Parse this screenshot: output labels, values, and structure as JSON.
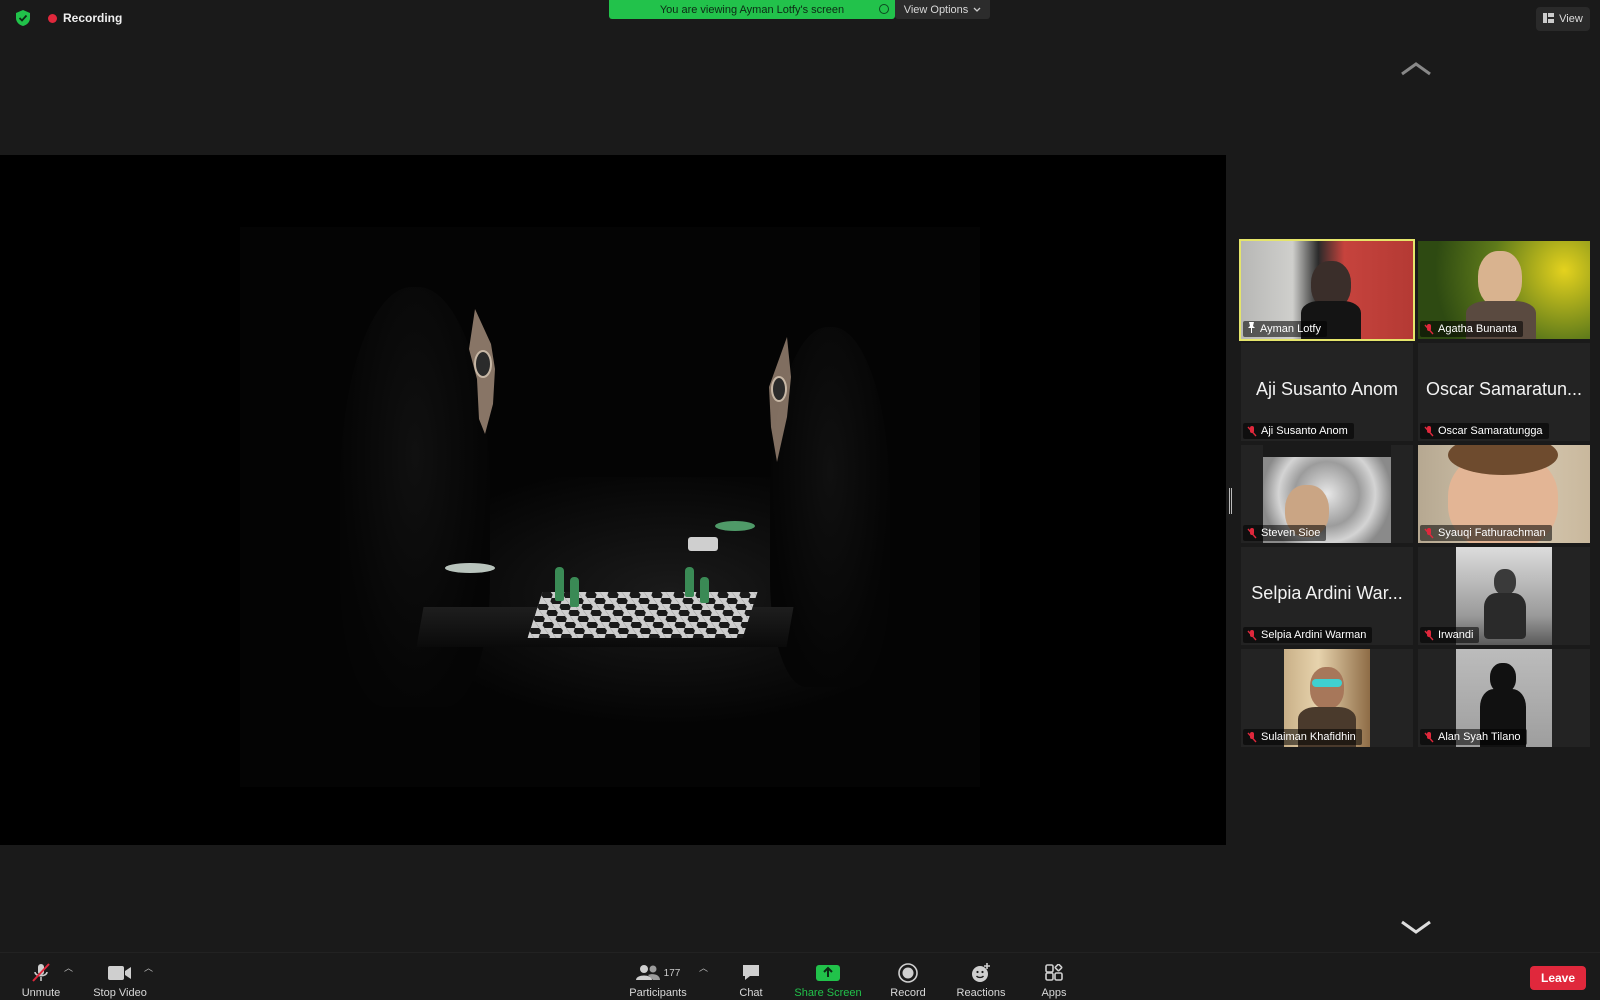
{
  "status": {
    "recording_label": "Recording"
  },
  "banner": {
    "viewing_text": "You are viewing Ayman Lotfy's screen",
    "view_options_label": "View Options"
  },
  "view_button": {
    "label": "View"
  },
  "participants": [
    {
      "display_name": "Ayman Lotfy",
      "big_name": "",
      "has_video": true,
      "pinned": true,
      "muted": false,
      "active_speaker": true
    },
    {
      "display_name": "Agatha Bunanta",
      "big_name": "",
      "has_video": true,
      "muted": true
    },
    {
      "display_name": "Aji Susanto Anom",
      "big_name": "Aji Susanto Anom",
      "has_video": false,
      "muted": true
    },
    {
      "display_name": "Oscar Samaratungga",
      "big_name": "Oscar Samaratun...",
      "has_video": false,
      "muted": true
    },
    {
      "display_name": "Steven Sioe",
      "big_name": "",
      "has_video": true,
      "muted": true
    },
    {
      "display_name": "Syauqi Fathurachman",
      "big_name": "",
      "has_video": true,
      "muted": true
    },
    {
      "display_name": "Selpia Ardini Warman",
      "big_name": "Selpia Ardini War...",
      "has_video": false,
      "muted": true
    },
    {
      "display_name": "Irwandi",
      "big_name": "",
      "has_video": true,
      "muted": true
    },
    {
      "display_name": "Sulaiman Khafidhin",
      "big_name": "",
      "has_video": true,
      "muted": true
    },
    {
      "display_name": "Alan Syah Tilano",
      "big_name": "",
      "has_video": true,
      "muted": true
    }
  ],
  "toolbar": {
    "unmute_label": "Unmute",
    "stop_video_label": "Stop Video",
    "participants_label": "Participants",
    "participants_count": "177",
    "chat_label": "Chat",
    "share_screen_label": "Share Screen",
    "record_label": "Record",
    "reactions_label": "Reactions",
    "apps_label": "Apps",
    "leave_label": "Leave"
  },
  "colors": {
    "share_green": "#21c24a",
    "leave_red": "#e0283c",
    "active_speaker": "#e5e56b"
  }
}
